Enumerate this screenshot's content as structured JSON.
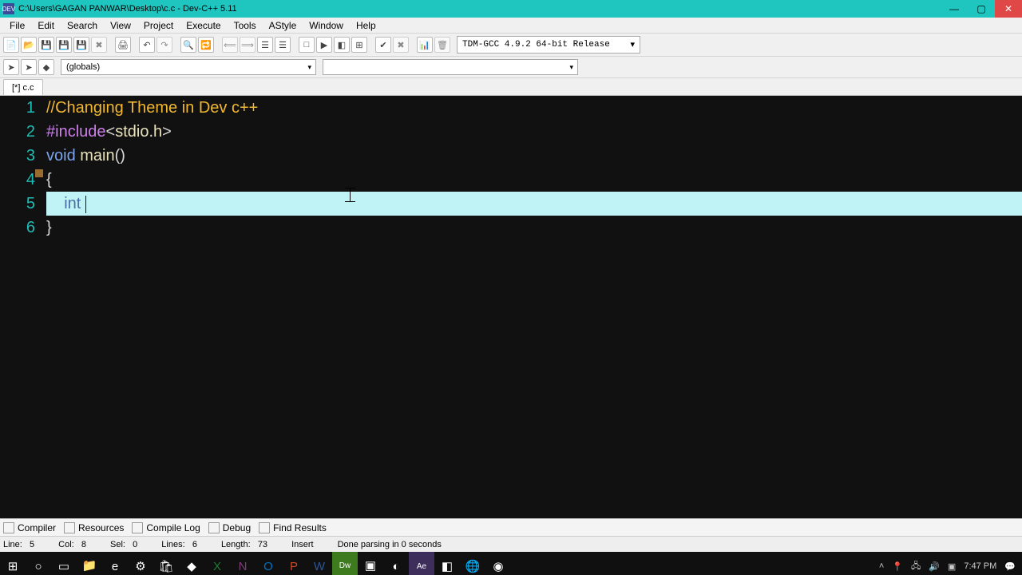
{
  "titlebar": {
    "title": "C:\\Users\\GAGAN PANWAR\\Desktop\\c.c - Dev-C++ 5.11",
    "icon_label": "DEV"
  },
  "menubar": {
    "items": [
      "File",
      "Edit",
      "Search",
      "View",
      "Project",
      "Execute",
      "Tools",
      "AStyle",
      "Window",
      "Help"
    ]
  },
  "compiler_selector": "TDM-GCC 4.9.2 64-bit Release",
  "scope_selector": "(globals)",
  "tab": {
    "label": "[*] c.c"
  },
  "code_lines": [
    {
      "n": 1,
      "parts": [
        {
          "cls": "comment",
          "t": "//Changing Theme in Dev c++"
        }
      ]
    },
    {
      "n": 2,
      "parts": [
        {
          "cls": "preproc",
          "t": "#include"
        },
        {
          "cls": "punc",
          "t": "<"
        },
        {
          "cls": "strlit",
          "t": "stdio.h"
        },
        {
          "cls": "punc",
          "t": ">"
        }
      ]
    },
    {
      "n": 3,
      "parts": [
        {
          "cls": "keyword",
          "t": "void"
        },
        {
          "cls": "punc",
          "t": " "
        },
        {
          "cls": "ident",
          "t": "main"
        },
        {
          "cls": "punc",
          "t": "()"
        }
      ]
    },
    {
      "n": 4,
      "parts": [
        {
          "cls": "punc",
          "t": "{"
        }
      ]
    },
    {
      "n": 5,
      "current": true,
      "parts": [
        {
          "cls": "punc",
          "t": "    "
        },
        {
          "cls": "keyword",
          "t": "int "
        }
      ]
    },
    {
      "n": 6,
      "parts": [
        {
          "cls": "punc",
          "t": "}"
        }
      ]
    }
  ],
  "bottom_tabs": [
    "Compiler",
    "Resources",
    "Compile Log",
    "Debug",
    "Find Results"
  ],
  "status": {
    "line_label": "Line:",
    "line": "5",
    "col_label": "Col:",
    "col": "8",
    "sel_label": "Sel:",
    "sel": "0",
    "lines_label": "Lines:",
    "lines": "6",
    "length_label": "Length:",
    "length": "73",
    "mode": "Insert",
    "msg": "Done parsing in 0 seconds"
  },
  "tray": {
    "time": "7:47 PM",
    "date": ""
  }
}
